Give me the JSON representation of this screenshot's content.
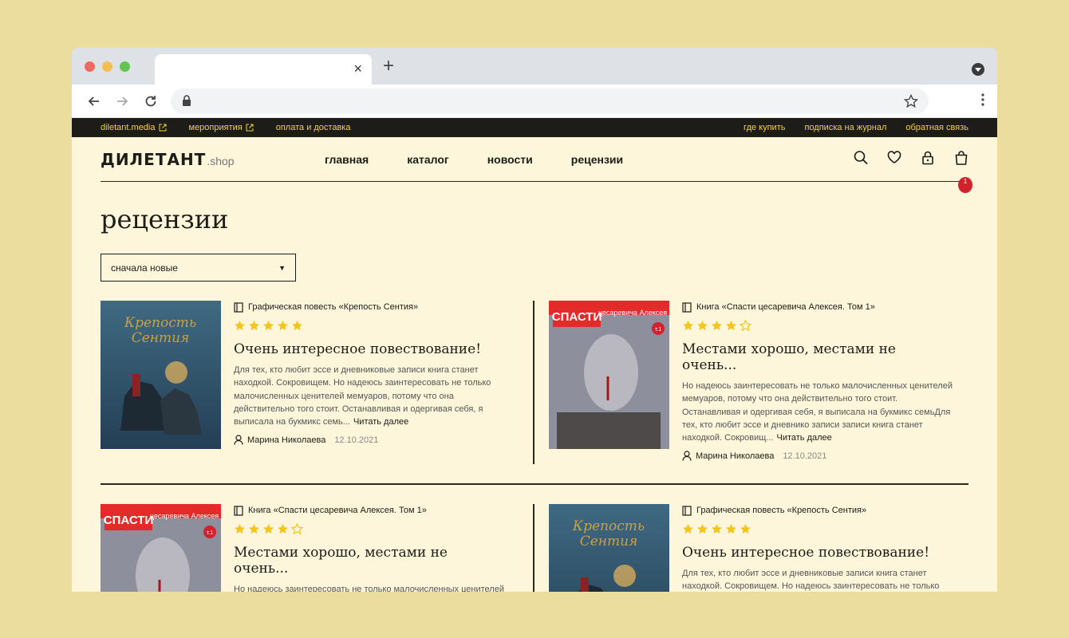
{
  "browser": {
    "tab_close": "×",
    "new_tab": "+"
  },
  "topbar": {
    "left": [
      {
        "label": "diletant.media",
        "external": true
      },
      {
        "label": "мероприятия",
        "external": true
      },
      {
        "label": "оплата и доставка",
        "external": false
      }
    ],
    "right": [
      {
        "label": "где купить"
      },
      {
        "label": "подписка на журнал"
      },
      {
        "label": "обратная связь"
      }
    ]
  },
  "header": {
    "logo_main": "ДИЛЕТАНТ",
    "logo_sub": ".shop",
    "nav": [
      "главная",
      "каталог",
      "новости",
      "рецензии"
    ],
    "cart_count": "1"
  },
  "page": {
    "title": "рецензии",
    "sort_value": "сначала новые"
  },
  "colors": {
    "accent": "#f2d23c",
    "background": "#fdf6da",
    "star": "#f5c518",
    "badge": "#d1222e"
  },
  "reviews": [
    {
      "cover": "krepost",
      "product": "Графическая повесть «Крепость Сентия»",
      "rating": 5,
      "title": "Очень интересное повествование!",
      "text": "Для тех, кто любит эссе и дневниковые записи книга станет находкой. Сокровищем. Но надеюсь заинтересовать не только малочисленных ценителей мемуаров, потому что она действительно того стоит. Останавливая и одергивая себя, я выписала на букмикс семь...",
      "more": "Читать далее",
      "author": "Марина Николаева",
      "date": "12.10.2021"
    },
    {
      "cover": "spasti",
      "product": "Книга «Спасти цесаревича Алексея. Том 1»",
      "rating": 4,
      "title": "Местами хорошо, местами не очень...",
      "text": "Но надеюсь заинтересовать не только малочисленных ценителей мемуаров, потому что она действительно того стоит. Останавливая и одергивая себя, я выписала на букмикс семьДля тех, кто любит эссе и дневнико записи записи книга станет находкой. Сокровищ...",
      "more": "Читать далее",
      "author": "Марина Николаева",
      "date": "12.10.2021"
    },
    {
      "cover": "spasti",
      "product": "Книга «Спасти цесаревича Алексея. Том 1»",
      "rating": 4,
      "title": "Местами хорошо, местами не очень...",
      "text": "Но надеюсь заинтересовать не только малочисленных ценителей мемуаров, потому что она действительно того стоит.",
      "more": "",
      "author": "",
      "date": ""
    },
    {
      "cover": "krepost",
      "product": "Графическая повесть «Крепость Сентия»",
      "rating": 5,
      "title": "Очень интересное повествование!",
      "text": "Для тех, кто любит эссе и дневниковые записи книга станет находкой. Сокровищем. Но надеюсь заинтересовать не только",
      "more": "",
      "author": "",
      "date": ""
    }
  ],
  "covers": {
    "krepost": {
      "title_line1": "Крепость",
      "title_line2": "Сентия"
    },
    "spasti": {
      "banner": "СПАСТИ",
      "sub": "цесаревича Алексея",
      "volume": "т.1"
    }
  }
}
